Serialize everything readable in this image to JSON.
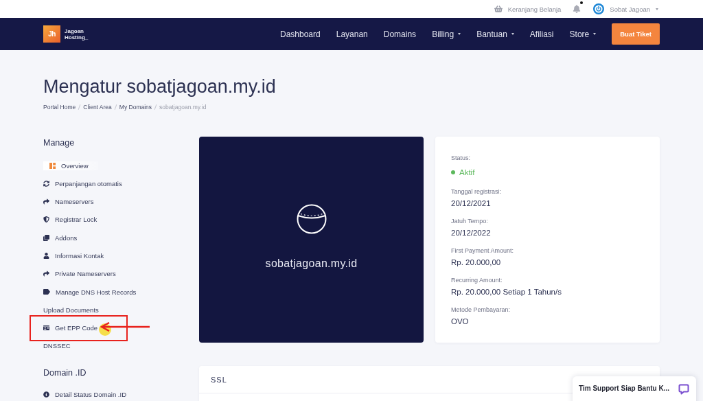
{
  "topbar": {
    "cart": "Keranjang Belanja",
    "notifications": {
      "unread": true
    },
    "user": "Sobat Jagoan"
  },
  "brand": {
    "mark": "Jh",
    "name_lines": [
      "Jagoan",
      "Hosting_"
    ]
  },
  "nav": [
    {
      "label": "Dashboard",
      "dropdown": false
    },
    {
      "label": "Layanan",
      "dropdown": false
    },
    {
      "label": "Domains",
      "dropdown": false
    },
    {
      "label": "Billing",
      "dropdown": true
    },
    {
      "label": "Bantuan",
      "dropdown": true
    },
    {
      "label": "Afiliasi",
      "dropdown": false
    },
    {
      "label": "Store",
      "dropdown": true
    }
  ],
  "action_button": "Buat Tiket",
  "page_title": "Mengatur sobatjagoan.my.id",
  "breadcrumb": [
    {
      "label": "Portal Home",
      "current": false
    },
    {
      "label": "Client Area",
      "current": false
    },
    {
      "label": "My Domains",
      "current": false
    },
    {
      "label": "sobatjagoan.my.id",
      "current": true
    }
  ],
  "sidebar": [
    {
      "heading": "Manage",
      "items": [
        {
          "label": "Overview",
          "kind": "icon",
          "selected": true,
          "highlighted": false
        },
        {
          "label": "Perpanjangan otomatis",
          "kind": "icon",
          "selected": false,
          "highlighted": false
        },
        {
          "label": "Nameservers",
          "kind": "icon",
          "selected": false,
          "highlighted": false
        },
        {
          "label": "Registrar Lock",
          "kind": "icon",
          "selected": false,
          "highlighted": false
        },
        {
          "label": "Addons",
          "kind": "icon",
          "selected": false,
          "highlighted": false
        },
        {
          "label": "Informasi Kontak",
          "kind": "icon",
          "selected": false,
          "highlighted": false
        },
        {
          "label": "Private Nameservers",
          "kind": "icon",
          "selected": false,
          "highlighted": false
        },
        {
          "label": "Manage DNS Host Records",
          "kind": "icon",
          "selected": false,
          "highlighted": false
        },
        {
          "label": "Upload Documents",
          "kind": "plain",
          "selected": false,
          "highlighted": false
        },
        {
          "label": "Get EPP Code",
          "kind": "icon",
          "selected": false,
          "highlighted": true
        },
        {
          "label": "DNSSEC",
          "kind": "plain",
          "selected": false,
          "highlighted": false
        }
      ]
    },
    {
      "heading": "Domain .ID",
      "items": [
        {
          "label": "Detail Status Domain .ID",
          "kind": "icon",
          "selected": false,
          "highlighted": false
        }
      ]
    }
  ],
  "domain_card": {
    "domain": "sobatjagoan.my.id"
  },
  "details": [
    {
      "label": "Status:",
      "value": "Aktif",
      "kind": "status",
      "color": "#5cb85c"
    },
    {
      "label": "Tanggal registrasi:",
      "value": "20/12/2021",
      "kind": "text"
    },
    {
      "label": "Jatuh Tempo:",
      "value": "20/12/2022",
      "kind": "text"
    },
    {
      "label": "First Payment Amount:",
      "value": "Rp. 20.000,00",
      "kind": "text"
    },
    {
      "label": "Recurring Amount:",
      "value": "Rp. 20.000,00 Setiap 1 Tahun/s",
      "kind": "text"
    },
    {
      "label": "Metode Pembayaran:",
      "value": "OVO",
      "kind": "text"
    }
  ],
  "ssl_panel": {
    "title": "SSL"
  },
  "chat_widget": {
    "label": "Tim Support Siap Bantu K..."
  }
}
